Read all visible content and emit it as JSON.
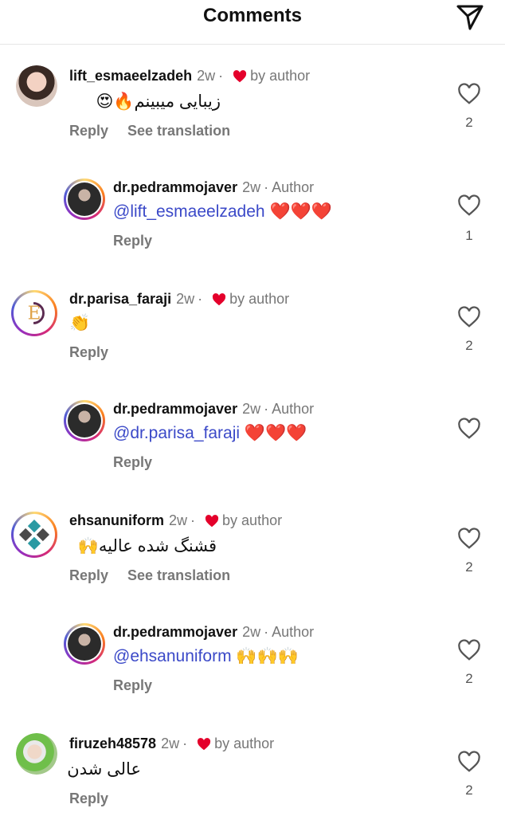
{
  "header": {
    "title": "Comments",
    "send_icon": "send-icon"
  },
  "colors": {
    "mention": "#3b49c8",
    "heart": "#e4002b"
  },
  "comments": [
    {
      "username": "lift_esmaeelzadeh",
      "time": "2w",
      "liked_by_author": "by author",
      "text": "زیبایی میبینم🔥😍",
      "actions": [
        "Reply",
        "See translation"
      ],
      "likes": "2"
    },
    {
      "username": "dr.pedrammojaver",
      "time": "2w",
      "author_tag": "Author",
      "mention": "@lift_esmaeelzadeh",
      "text": "❤️❤️❤️",
      "actions": [
        "Reply"
      ],
      "likes": "1"
    },
    {
      "username": "dr.parisa_faraji",
      "time": "2w",
      "liked_by_author": "by author",
      "text": "👏",
      "actions": [
        "Reply"
      ],
      "likes": "2"
    },
    {
      "username": "dr.pedrammojaver",
      "time": "2w",
      "author_tag": "Author",
      "mention": "@dr.parisa_faraji",
      "text": "❤️❤️❤️",
      "actions": [
        "Reply"
      ],
      "likes": ""
    },
    {
      "username": "ehsanuniform",
      "time": "2w",
      "liked_by_author": "by author",
      "text": "قشنگ شده عالیه🙌",
      "actions": [
        "Reply",
        "See translation"
      ],
      "likes": "2"
    },
    {
      "username": "dr.pedrammojaver",
      "time": "2w",
      "author_tag": "Author",
      "mention": "@ehsanuniform",
      "text": "🙌🙌🙌",
      "actions": [
        "Reply"
      ],
      "likes": "2"
    },
    {
      "username": "firuzeh48578",
      "time": "2w",
      "liked_by_author": "by author",
      "text": "عالی شدن",
      "actions": [
        "Reply"
      ],
      "likes": "2"
    }
  ]
}
